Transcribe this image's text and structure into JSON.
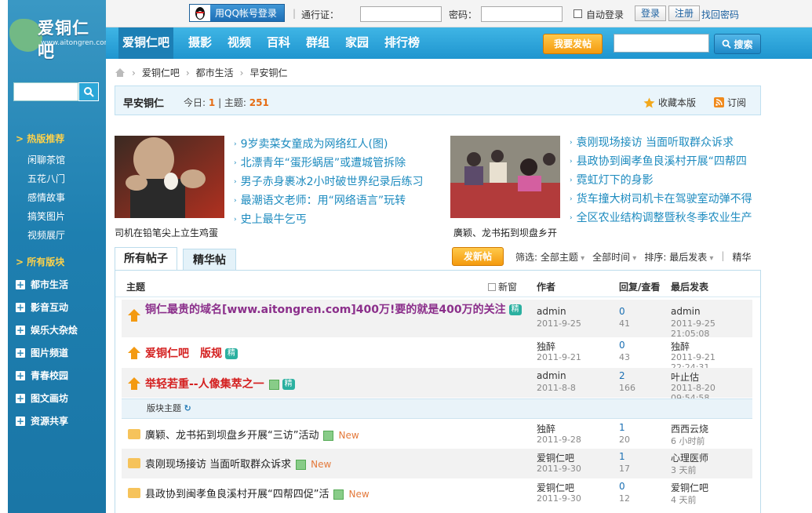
{
  "sidebar": {
    "brand": "爱铜仁吧",
    "domain": "www.aitongren.com",
    "hot_title": "> 热版推荐",
    "hot_items": [
      "闲聊茶馆",
      "五花八门",
      "感情故事",
      "搞笑图片",
      "视频展厅"
    ],
    "all_title": "> 所有版块",
    "categories": [
      "都市生活",
      "影音互动",
      "娱乐大杂烩",
      "图片频道",
      "青春校园",
      "图文画坊",
      "资源共享"
    ]
  },
  "topbar": {
    "qq_login": "用QQ帐号登录",
    "pass_label": "通行证：",
    "pwd_label": "密码：",
    "auto_login": "自动登录",
    "login_btn": "登录",
    "register_btn": "注册",
    "forgot": "找回密码"
  },
  "nav": {
    "items": [
      "爱铜仁吧",
      "摄影",
      "视频",
      "百科",
      "群组",
      "家园",
      "排行榜"
    ],
    "post_btn": "我要发帖",
    "search_btn": "搜索"
  },
  "breadcrumb": [
    "爱铜仁吧",
    "都市生活",
    "早安铜仁"
  ],
  "forum": {
    "name": "早安铜仁",
    "today_label": "今日:",
    "today": "1",
    "topics_label": "主题:",
    "topics": "251",
    "fav": "收藏本版",
    "rss": "订阅"
  },
  "feature": {
    "left_caption": "司机在铅笔尖上立生鸡蛋",
    "left_headlines": [
      "9岁卖菜女童成为网络红人(图)",
      "北漂青年“蛋形蜗居”或遭城管拆除",
      "男子赤身裹冰2小时破世界纪录后练习",
      "最潮语文老师：用“网络语言”玩转",
      "史上最牛乞丐"
    ],
    "right_caption": "廣颖、龙书拓到坝盘乡开",
    "right_headlines": [
      "袁刚现场接访 当面听取群众诉求",
      "县政协到闽孝鱼良溪村开展“四帮四",
      "霓虹灯下的身影",
      "货车撞大树司机卡在驾驶室动弹不得",
      "全区农业结构调整暨秋冬季农业生产"
    ]
  },
  "tabs": [
    "所有帖子",
    "精华帖"
  ],
  "toolbar": {
    "new_post": "发新帖",
    "filter_label": "筛选:",
    "filter_topic": "全部主题",
    "filter_time": "全部时间",
    "sort_label": "排序:",
    "sort_value": "最后发表",
    "digest": "精华"
  },
  "list": {
    "col_topic": "主题",
    "new_window": "新窗",
    "col_author": "作者",
    "col_reply": "回复/查看",
    "col_last": "最后发表",
    "section_label": "版块主题",
    "sticky": [
      {
        "title": "铜仁最贵的域名[www.aitongren.com]400万!要的就是400万的关注",
        "badge": "精",
        "author": "admin",
        "date": "2011-9-25",
        "replies": "0",
        "views": "41",
        "last_user": "admin",
        "last_time": "2011-9-25 21:05:08",
        "color": "#8b2f8b"
      },
      {
        "title": "爱铜仁吧　版规",
        "badge": "精",
        "author": "独醉",
        "date": "2011-9-21",
        "replies": "0",
        "views": "43",
        "last_user": "独醉",
        "last_time": "2011-9-21 22:24:31",
        "color": "#d42020"
      },
      {
        "title": "举轻若重--人像集萃之一",
        "badge": "精",
        "author": "admin",
        "date": "2011-8-8",
        "replies": "2",
        "views": "166",
        "last_user": "叶止估",
        "last_time": "2011-8-20 09:54:58",
        "color": "#d42020"
      }
    ],
    "normal": [
      {
        "title": "廣颖、龙书拓到坝盘乡开展“三访”活动",
        "new": "New",
        "author": "独醉",
        "date": "2011-9-28",
        "replies": "1",
        "views": "20",
        "last_user": "西西云烧",
        "last_time": "6 小时前"
      },
      {
        "title": "袁刚现场接访 当面听取群众诉求",
        "new": "New",
        "author": "爱铜仁吧",
        "date": "2011-9-30",
        "replies": "1",
        "views": "17",
        "last_user": "心理医师",
        "last_time": "3 天前"
      },
      {
        "title": "县政协到闽孝鱼良溪村开展“四帮四促”活",
        "new": "New",
        "author": "爱铜仁吧",
        "date": "2011-9-30",
        "replies": "0",
        "views": "12",
        "last_user": "爱铜仁吧",
        "last_time": "4 天前"
      }
    ]
  }
}
